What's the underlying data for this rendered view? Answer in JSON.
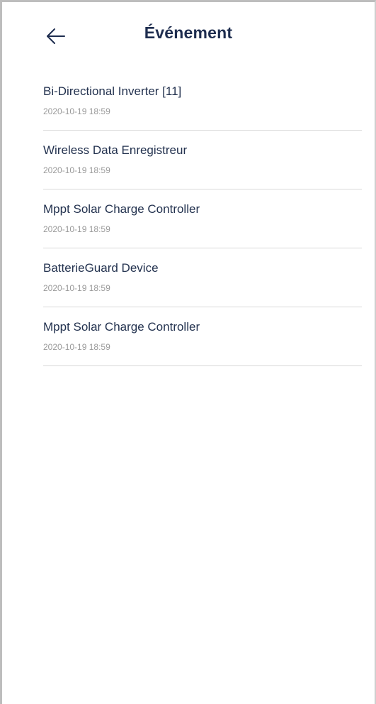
{
  "header": {
    "back_icon": "arrow-left-icon",
    "title": "Événement"
  },
  "events": [
    {
      "title": "Bi-Directional Inverter [11]",
      "time": "2020-10-19 18:59"
    },
    {
      "title": "Wireless Data Enregistreur",
      "time": "2020-10-19 18:59"
    },
    {
      "title": "Mppt Solar Charge Controller",
      "time": "2020-10-19 18:59"
    },
    {
      "title": "BatterieGuard Device",
      "time": "2020-10-19 18:59"
    },
    {
      "title": "Mppt Solar Charge Controller",
      "time": "2020-10-19 18:59"
    }
  ],
  "colors": {
    "title": "#1e2d4f",
    "item_text": "#23324f",
    "timestamp": "#9a9a9a",
    "divider": "#d9d9d9"
  }
}
